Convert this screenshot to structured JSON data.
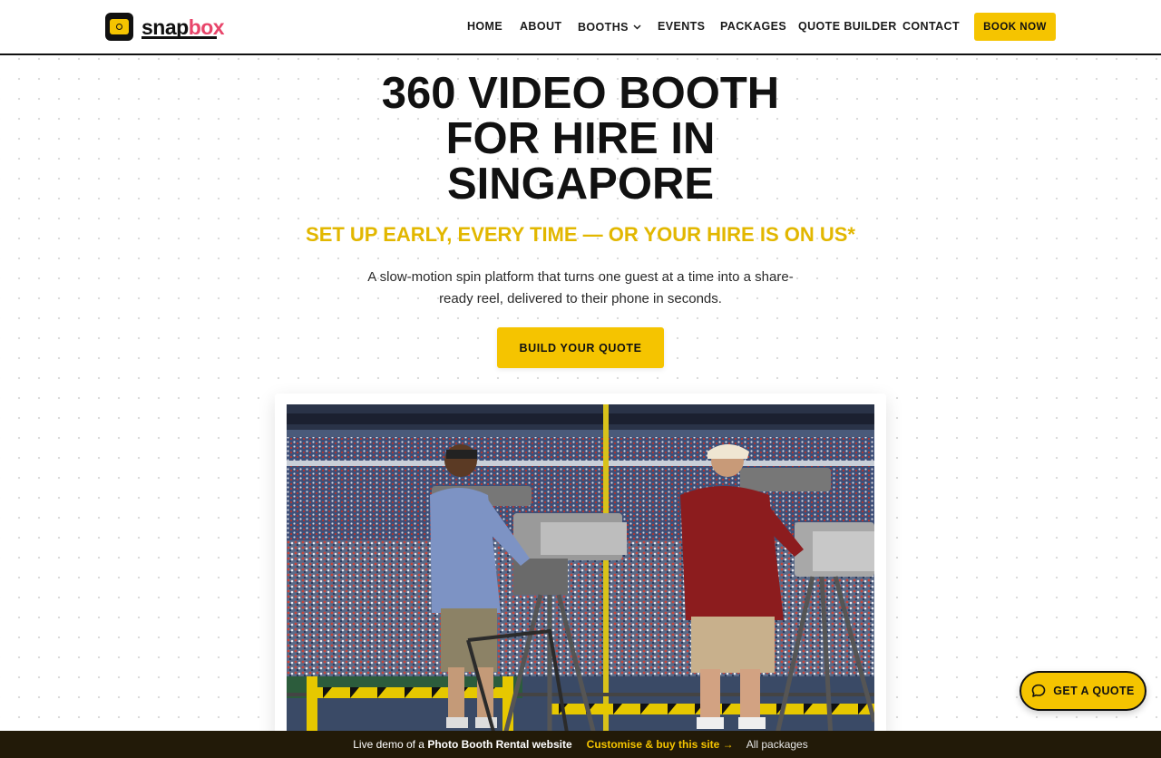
{
  "header": {
    "logo_text_part1": "snap",
    "logo_text_part2": "box",
    "nav": {
      "home": "HOME",
      "about": "ABOUT",
      "booths": "BOOTHS",
      "events": "EVENTS",
      "packages": "PACKAGES",
      "quote_builder": "QUOTE BUILDER",
      "contact": "CONTACT"
    },
    "book_now": "BOOK NOW"
  },
  "hero": {
    "title_line1": "360 VIDEO BOOTH",
    "title_line2": "FOR HIRE IN",
    "title_line3": "SINGAPORE",
    "subtitle": "SET UP EARLY, EVERY TIME — OR YOUR HIRE IS ON US*",
    "description": "A slow-motion spin platform that turns one guest at a time into a share-ready reel, delivered to their phone in seconds.",
    "cta": "BUILD YOUR QUOTE"
  },
  "floating": {
    "label": "GET A QUOTE",
    "icon": "chat-bubble-icon"
  },
  "demo_bar": {
    "prefix": "Live demo of a ",
    "site_type": "Photo Booth Rental website",
    "customize": "Customise & buy this site →",
    "all_packages": "All packages"
  },
  "colors": {
    "accent": "#f5c400",
    "subtitle": "#e2b700",
    "brand_pink": "#e8456a",
    "dark": "#111111",
    "demo_bar_bg": "#221a08"
  }
}
